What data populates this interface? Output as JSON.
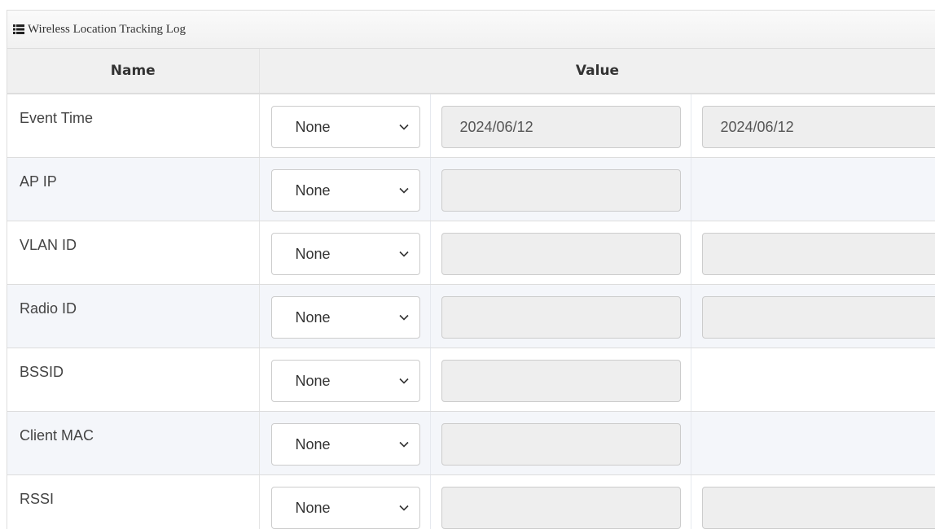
{
  "panel": {
    "title": "Wireless Location Tracking Log",
    "icon": "list-icon"
  },
  "table": {
    "headers": {
      "name": "Name",
      "value": "Value"
    },
    "rows": [
      {
        "name": "Event Time",
        "operator": "None",
        "value1": "2024/06/12",
        "value2": "2024/06/12"
      },
      {
        "name": "AP IP",
        "operator": "None",
        "value1": ""
      },
      {
        "name": "VLAN ID",
        "operator": "None",
        "value1": "",
        "value2": ""
      },
      {
        "name": "Radio ID",
        "operator": "None",
        "value1": "",
        "value2": ""
      },
      {
        "name": "BSSID",
        "operator": "None",
        "value1": ""
      },
      {
        "name": "Client MAC",
        "operator": "None",
        "value1": ""
      },
      {
        "name": "RSSI",
        "operator": "None",
        "value1": "",
        "value2": ""
      }
    ]
  },
  "colors": {
    "header_bg": "#f0f0f0",
    "stripe_bg": "#f4f6fa",
    "input_disabled_bg": "#eeeeee",
    "border": "#dddddd"
  }
}
